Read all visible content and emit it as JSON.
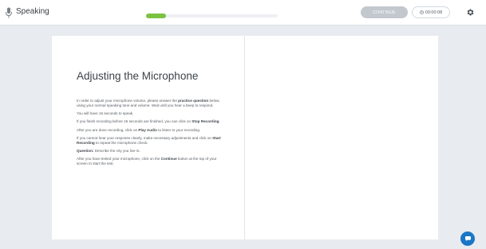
{
  "header": {
    "section_title": "Speaking",
    "progress": 0.15,
    "continue_label": "CONTINUE",
    "timer": "00:00:08"
  },
  "document": {
    "title": "Adjusting the Microphone",
    "p1_pre": "In order to adjust your microphone volume, please answer the ",
    "p1_bold": "practice question",
    "p1_post": " below, using your normal speaking tone and volume. Wait until you hear a beep to respond.",
    "p2": "You will have 15 seconds to speak.",
    "p3_pre": "If you finish recording before 15 seconds are finished, you can click on ",
    "p3_bold": "Stop Recording",
    "p3_post": ".",
    "p4_pre": "After you are done recording, click on ",
    "p4_bold": "Play Audio",
    "p4_post": " to listen to your recording.",
    "p5_pre": "If you cannot hear your response clearly, make necessary adjustments and click on ",
    "p5_bold": "Start Recording",
    "p5_post": " to repeat the microphone check.",
    "q_bold": "Question:",
    "q_text": " Describe the city you live in.",
    "p6_pre": "After you have tested your microphone, click on the ",
    "p6_bold": "Continue",
    "p6_post": " button at the top of your screen to start the test."
  },
  "colors": {
    "progress": "#7cc242",
    "continue_disabled": "#c3c8ce",
    "chat": "#1976c6",
    "background": "#e8ebef"
  },
  "icons": {
    "section": "microphone-icon",
    "timer": "clock-icon",
    "settings": "gear-icon",
    "chat": "chat-icon"
  }
}
